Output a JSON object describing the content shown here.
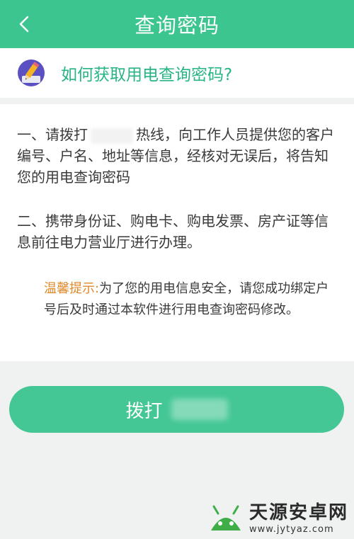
{
  "header": {
    "title": "查询密码",
    "back_icon": "chevron-left-icon"
  },
  "how": {
    "icon": "pencil-icon",
    "text": "如何获取用电查询密码?"
  },
  "steps": {
    "step1_before": "一、请拨打",
    "step1_after": "热线，向工作人员提供您的客户编号、户名、地址等信息，经核对无误后，将告知您的用电查询密码",
    "step2": "二、携带身份证、购电卡、购电发票、房产证等信息前往电力营业厅进行办理。"
  },
  "tip": {
    "label": "温馨提示:",
    "text": "为了您的用电信息安全，请您成功绑定户号后及时通过本软件进行用电查询密码修改。"
  },
  "call_button": {
    "label": "拨打"
  },
  "watermark": {
    "name": "天源安卓网",
    "url": "www.jytyaz.com"
  },
  "colors": {
    "brand": "#3cc58e",
    "accent_text": "#28b487",
    "tip_label": "#e08a2c"
  }
}
